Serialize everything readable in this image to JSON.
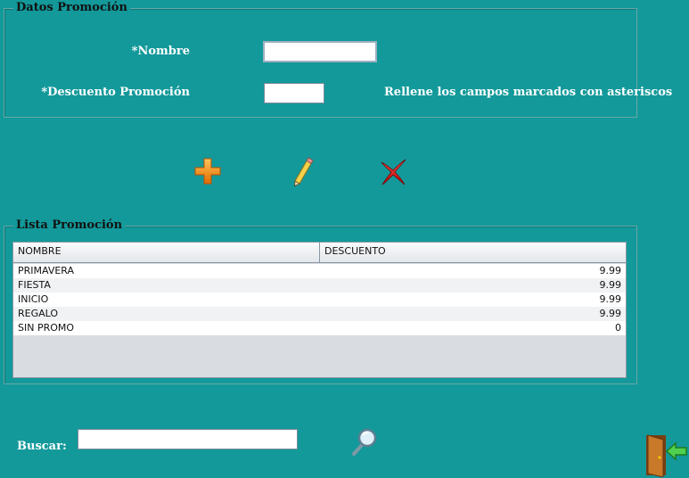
{
  "datos": {
    "legend": "Datos Promoción",
    "nombre_label": "*Nombre",
    "nombre_value": "",
    "descuento_label": "*Descuento Promoción",
    "descuento_value": "",
    "hint": "Rellene los campos marcados con asteriscos"
  },
  "toolbar": {
    "add_icon": "plus-icon",
    "edit_icon": "pencil-icon",
    "delete_icon": "x-icon",
    "colors": {
      "add": "#f08a10",
      "delete": "#d81818"
    }
  },
  "lista": {
    "legend": "Lista Promoción",
    "columns": [
      "NOMBRE",
      "DESCUENTO"
    ],
    "rows": [
      [
        "PRIMAVERA",
        "9.99"
      ],
      [
        "FIESTA",
        "9.99"
      ],
      [
        "INICIO",
        "9.99"
      ],
      [
        "REGALO",
        "9.99"
      ],
      [
        "SIN PROMO",
        "0"
      ]
    ]
  },
  "search": {
    "label": "Buscar:",
    "value": "",
    "icon": "magnifier-icon"
  },
  "exit": {
    "icon": "exit-door-icon"
  }
}
